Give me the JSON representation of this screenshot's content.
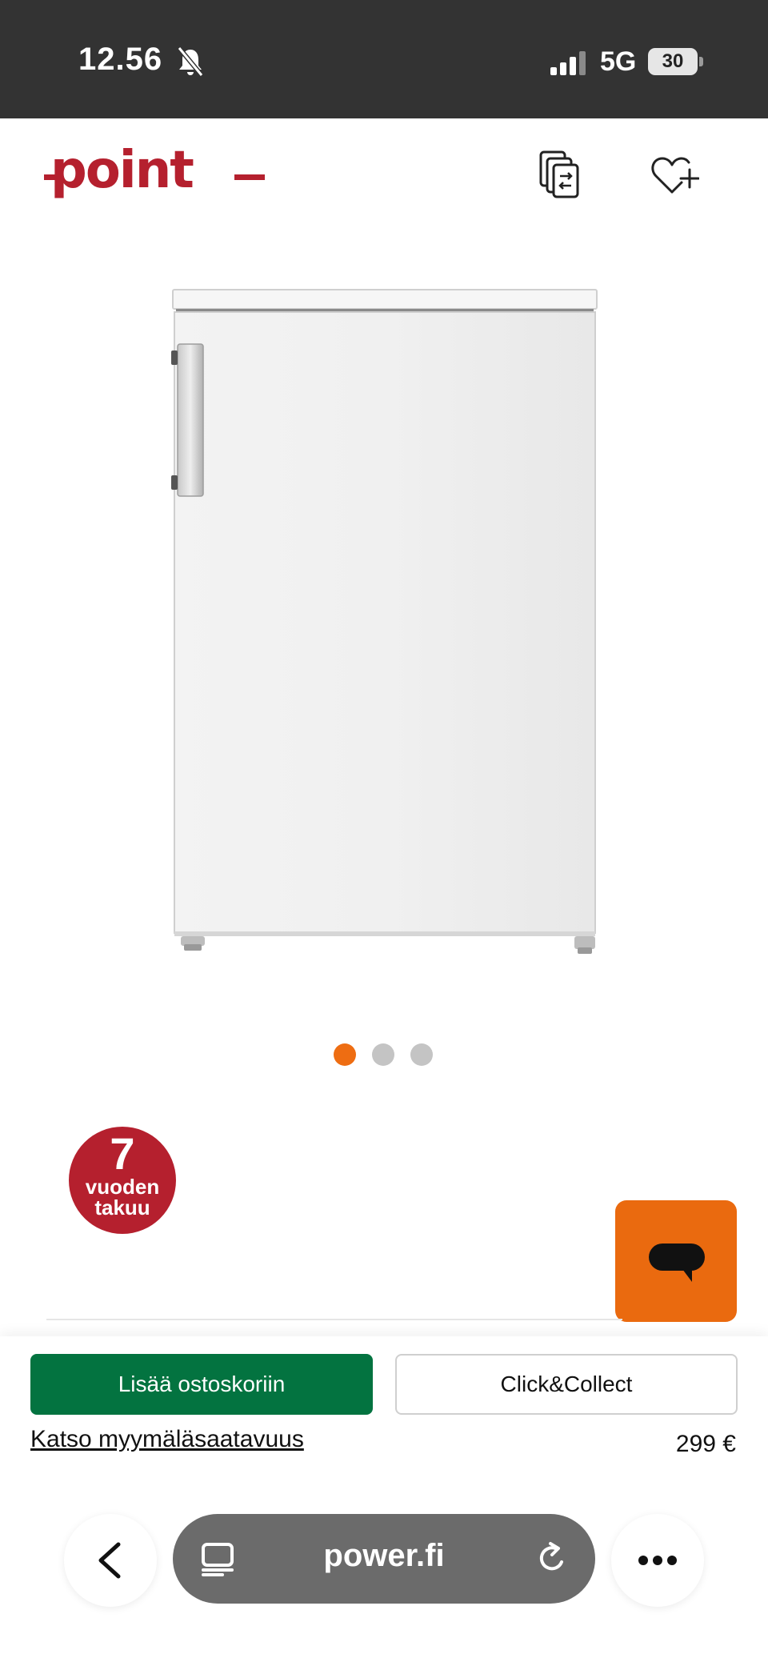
{
  "status_bar": {
    "time": "12.56",
    "network": "5G",
    "battery": "30",
    "icons": [
      "bell-slash-icon",
      "signal-icon",
      "battery-icon"
    ]
  },
  "header": {
    "logo_text": "point",
    "brand_color": "#b5202e",
    "icons": [
      "compare-icon",
      "wishlist-heart-plus-icon"
    ]
  },
  "carousel": {
    "slide_count": 3,
    "active_index": 0,
    "active_color": "#ee6d12",
    "inactive_color": "#c4c4c4"
  },
  "warranty_badge": {
    "years": "7",
    "line1": "vuoden",
    "line2": "takuu",
    "color": "#b5202e"
  },
  "chat": {
    "icon": "chat-bubble-icon",
    "color": "#ea6a0f"
  },
  "buy_bar": {
    "add_to_cart_label": "Lisää ostoskoriin",
    "add_to_cart_color": "#037340",
    "click_collect_label": "Click&Collect",
    "availability_link": "Katso myymäläsaatavuus",
    "price": "299 €"
  },
  "browser": {
    "url": "power.fi",
    "icons": [
      "back-chevron-icon",
      "reader-icon",
      "reload-icon",
      "more-icon"
    ]
  }
}
